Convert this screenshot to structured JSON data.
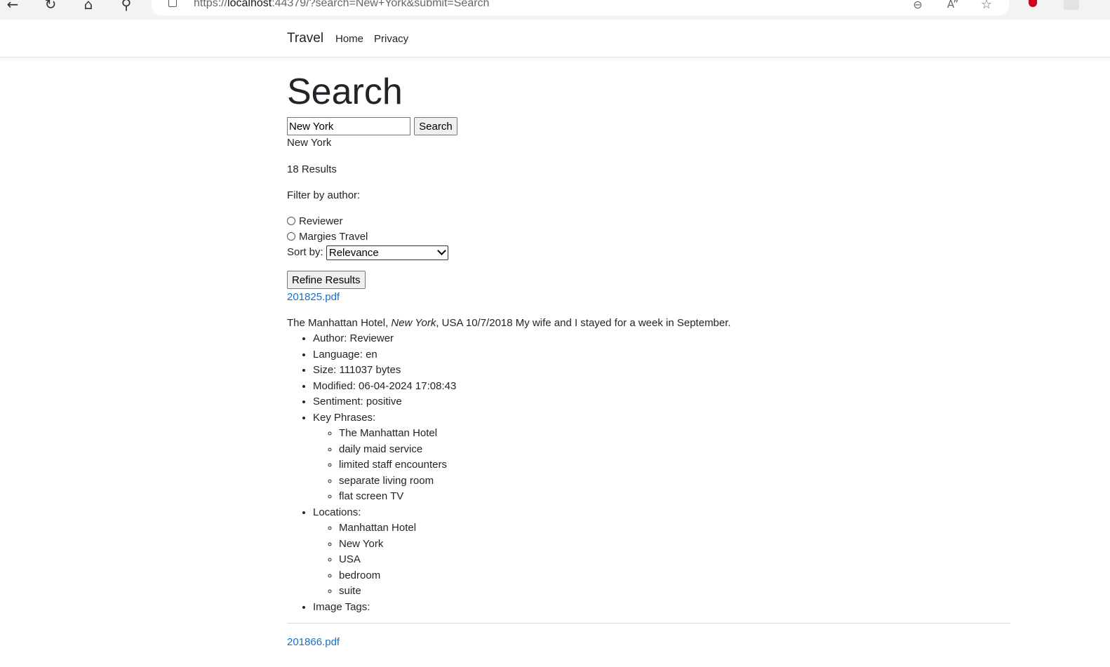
{
  "browser": {
    "url_host": "localhost",
    "url_prefix": "https://",
    "url_suffix": ":44379/?search=New+York&submit=Search"
  },
  "navbar": {
    "brand": "Travel",
    "links": [
      "Home",
      "Privacy"
    ]
  },
  "page": {
    "title": "Search",
    "search_value": "New York",
    "search_button": "Search",
    "query_echo": "New York",
    "results_count": "18 Results",
    "filter_label": "Filter by author:",
    "authors": [
      "Reviewer",
      "Margies Travel"
    ],
    "sort_label": "Sort by:",
    "sort_selected": "Relevance",
    "refine_button": "Refine Results"
  },
  "results": [
    {
      "file": "201825.pdf",
      "snippet_before": "The Manhattan Hotel, ",
      "snippet_em": "New York",
      "snippet_after": ", USA 10/7/2018 My wife and I stayed for a week in September.",
      "author": "Author: Reviewer",
      "language": "Language: en",
      "size": "Size: 111037 bytes",
      "modified": "Modified: 06-04-2024 17:08:43",
      "sentiment": "Sentiment: positive",
      "key_phrases_label": "Key Phrases:",
      "key_phrases": [
        "The Manhattan Hotel",
        "daily maid service",
        "limited staff encounters",
        "separate living room",
        "flat screen TV"
      ],
      "locations_label": "Locations:",
      "locations": [
        "Manhattan Hotel",
        "New York",
        "USA",
        "bedroom",
        "suite"
      ],
      "image_tags_label": "Image Tags:"
    },
    {
      "file": "201866.pdf"
    }
  ]
}
